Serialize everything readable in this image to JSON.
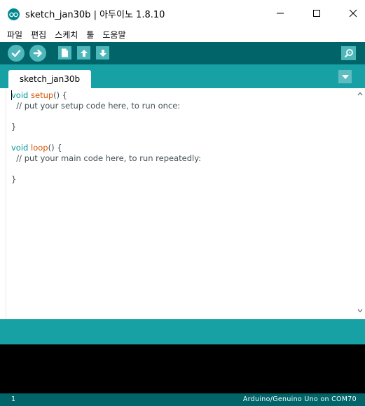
{
  "window": {
    "title": "sketch_jan30b | 아두이노 1.8.10",
    "icons": {
      "logo": "arduino-logo-icon",
      "minimize": "minimize-icon",
      "maximize": "maximize-icon",
      "close": "close-icon"
    }
  },
  "menubar": {
    "items": [
      {
        "label": "파일"
      },
      {
        "label": "편집"
      },
      {
        "label": "스케치"
      },
      {
        "label": "툴"
      },
      {
        "label": "도움말"
      }
    ]
  },
  "toolbar": {
    "buttons": [
      {
        "name": "verify",
        "icon": "checkmark-icon"
      },
      {
        "name": "upload",
        "icon": "arrow-right-icon"
      },
      {
        "name": "new",
        "icon": "new-file-icon"
      },
      {
        "name": "open",
        "icon": "arrow-up-icon"
      },
      {
        "name": "save",
        "icon": "arrow-down-icon"
      }
    ],
    "serial_monitor_icon": "magnifier-icon"
  },
  "tabs": {
    "active": "sketch_jan30b",
    "menu_icon": "triangle-down-icon"
  },
  "editor": {
    "lines": [
      {
        "kw": "void",
        "fn": "setup",
        "rest": "() {"
      },
      {
        "text": "  // put your setup code here, to run once:"
      },
      {
        "text": ""
      },
      {
        "text": "}"
      },
      {
        "text": ""
      },
      {
        "kw": "void",
        "fn": "loop",
        "rest": "() {"
      },
      {
        "text": "  // put your main code here, to run repeatedly:"
      },
      {
        "text": ""
      },
      {
        "text": "}"
      }
    ]
  },
  "statusbar": {
    "line": "1",
    "board": "Arduino/Genuino Uno on COM70"
  },
  "colors": {
    "toolbar_bg": "#006468",
    "tabstrip_bg": "#17a1a5",
    "button_bg": "#4db7bb",
    "keyword": "#00979c",
    "function": "#d35400",
    "console_bg": "#000000"
  }
}
